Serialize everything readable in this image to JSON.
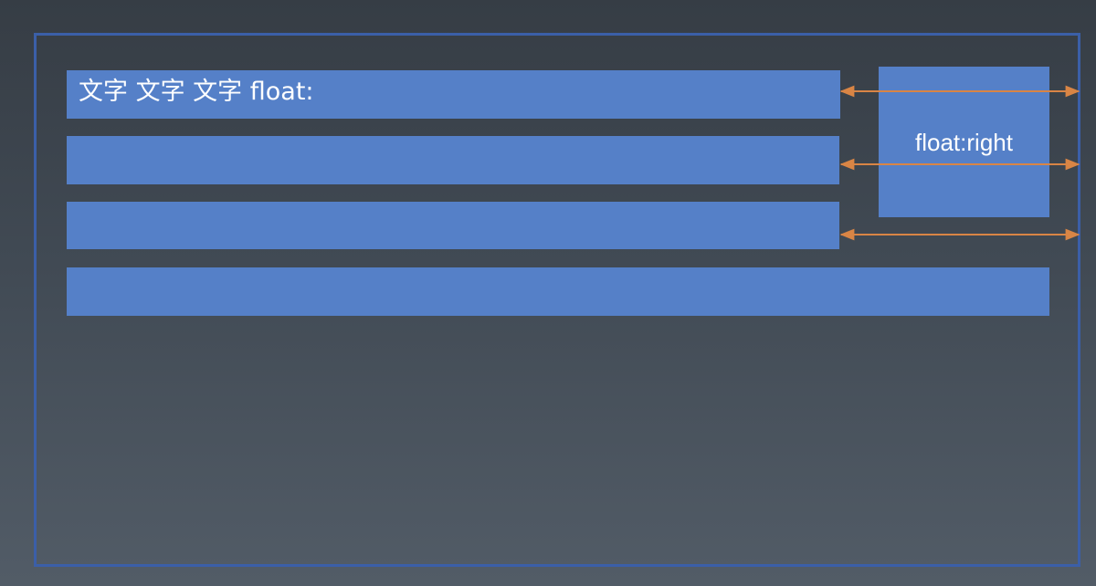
{
  "diagram": {
    "line_1_text": "文字 文字 文字 float:",
    "float_box_label": "float:right",
    "colors": {
      "background_top": "#363d45",
      "background_bottom": "#525c67",
      "container_border": "#3b5fa8",
      "block_fill": "#5580c8",
      "arrow": "#d98545",
      "text": "#ffffff"
    }
  }
}
